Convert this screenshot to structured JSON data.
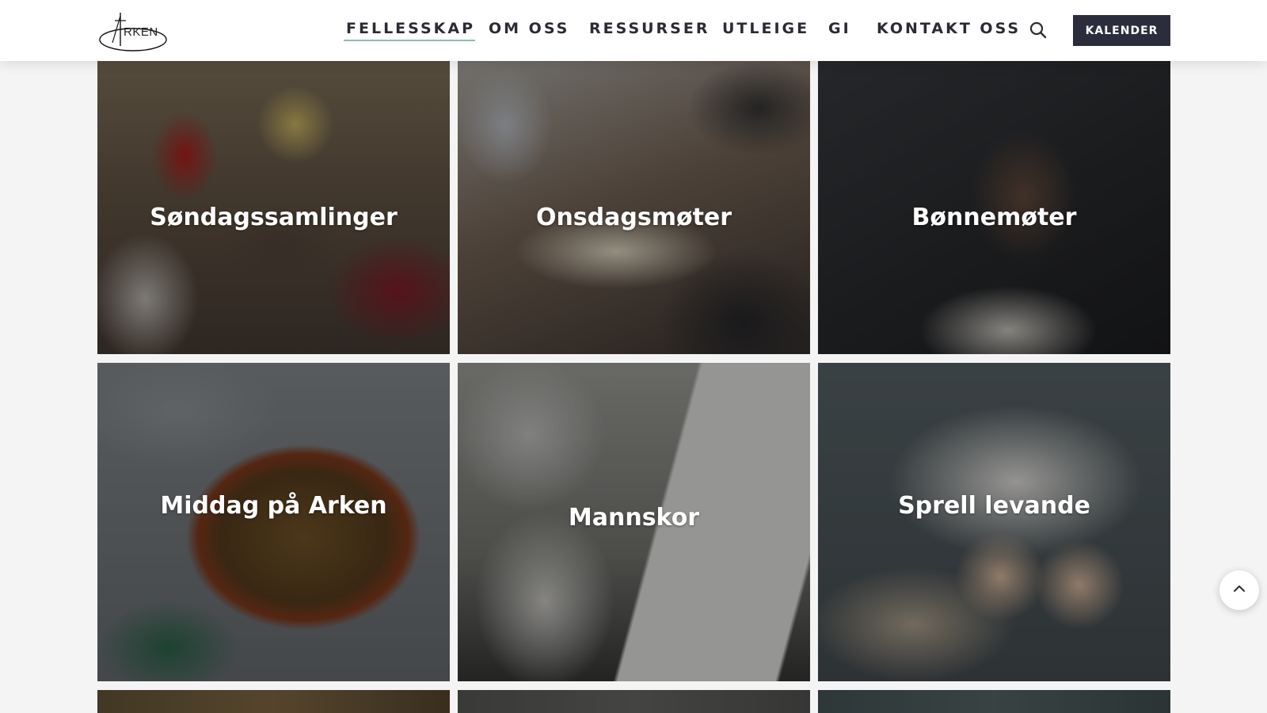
{
  "logo": {
    "text": "RKEN",
    "alt_letter": "A"
  },
  "nav": {
    "items": [
      {
        "label": "FELLESSKAP",
        "active": true
      },
      {
        "label": "OM OSS",
        "active": false
      },
      {
        "label": "RESSURSER",
        "active": false
      },
      {
        "label": "UTLEIGE",
        "active": false
      },
      {
        "label": "GI",
        "active": false
      },
      {
        "label": "KONTAKT OSS",
        "active": false
      }
    ],
    "search_icon": "search-icon",
    "cta_label": "KALENDER"
  },
  "colors": {
    "header_bg": "#ffffff",
    "nav_text": "#2b2b33",
    "active_underline": "#8fb9b4",
    "cta_bg": "#2b2d3c",
    "page_bg": "#f4f4f4"
  },
  "cards": [
    {
      "title": "Søndagssamlinger"
    },
    {
      "title": "Onsdagsmøter"
    },
    {
      "title": "Bønnemøter"
    },
    {
      "title": "Middag på Arken"
    },
    {
      "title": "Mannskor"
    },
    {
      "title": "Sprell levande"
    }
  ],
  "scroll_top_icon": "chevron-up-icon"
}
